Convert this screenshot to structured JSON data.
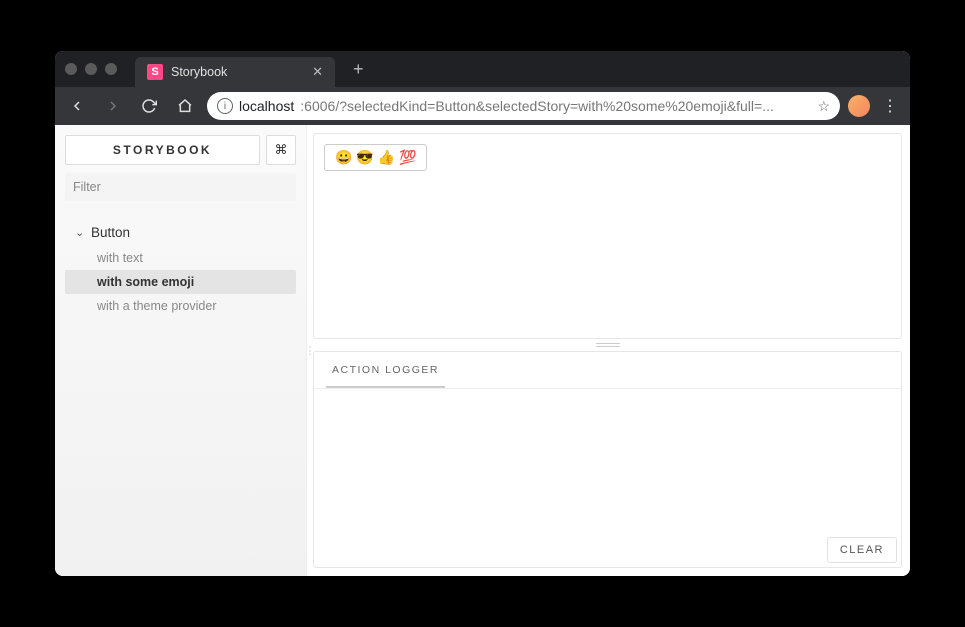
{
  "browser": {
    "tab_title": "Storybook",
    "favicon_letter": "S",
    "url_host": "localhost",
    "url_port": ":6006",
    "url_path": "/?selectedKind=Button&selectedStory=with%20some%20emoji&full=..."
  },
  "sidebar": {
    "brand": "STORYBOOK",
    "shortcut_glyph": "⌘",
    "filter_placeholder": "Filter",
    "kinds": [
      {
        "name": "Button",
        "expanded": true,
        "stories": [
          {
            "name": "with text",
            "active": false
          },
          {
            "name": "with some emoji",
            "active": true
          },
          {
            "name": "with a theme provider",
            "active": false
          }
        ]
      }
    ]
  },
  "preview": {
    "button_content": "😀 😎 👍 💯"
  },
  "addons": {
    "tab_label": "ACTION LOGGER",
    "clear_label": "CLEAR"
  }
}
